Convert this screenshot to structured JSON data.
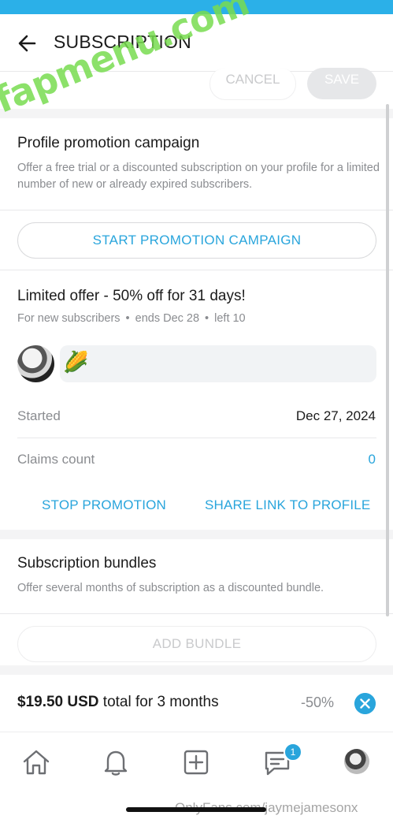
{
  "header": {
    "title": "SUBSCRIPTION"
  },
  "toolbar": {
    "cancel_label": "CANCEL",
    "save_label": "SAVE"
  },
  "promotion": {
    "title": "Profile promotion campaign",
    "description": "Offer a free trial or a discounted subscription on your profile for a limited number of new or already expired subscribers.",
    "start_label": "START PROMOTION CAMPAIGN"
  },
  "offer": {
    "title": "Limited offer - 50% off for 31 days!",
    "audience": "For new subscribers",
    "ends": "ends Dec 28",
    "left": "left 10",
    "emoji": "🌽",
    "started_label": "Started",
    "started_value": "Dec 27, 2024",
    "claims_label": "Claims count",
    "claims_value": "0",
    "stop_label": "STOP PROMOTION",
    "share_label": "SHARE LINK TO PROFILE"
  },
  "bundles": {
    "title": "Subscription bundles",
    "description": "Offer several months of subscription as a discounted bundle.",
    "add_label": "ADD BUNDLE",
    "item": {
      "price": "$19.50 USD",
      "rest": " total for 3 months",
      "discount": "-50%"
    }
  },
  "tabbar": {
    "messages_badge": "1"
  },
  "watermarks": {
    "overlay": "fapmenu.com",
    "bottom": "OnlyFans.com/jaymejamesonx"
  },
  "colors": {
    "accent": "#29a5dc",
    "status_bar": "#2bb0e8"
  }
}
